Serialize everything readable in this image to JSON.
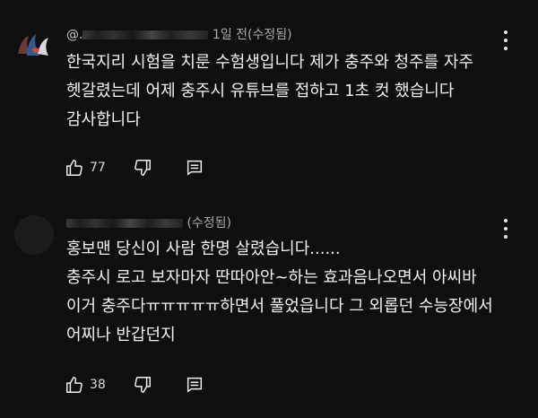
{
  "comments": [
    {
      "handle": "@.",
      "time": "1일 전(수정됨)",
      "lines": [
        "한국지리 시험을 치룬 수험생입니다 제가 충주와 청주를 자주",
        "헷갈렸는데 어제 충주시 유튜브를 접하고 1초 컷 했습니다",
        "감사합니다"
      ],
      "likes": "77"
    },
    {
      "handle": "",
      "time": "(수정됨)",
      "lines": [
        "홍보맨 당신이 사람 한명 살렸습니다......",
        "충주시 로고 보자마자 딴따아안~하는 효과음나오면서 아씨바",
        "이거 충주다ㅠㅠㅠㅠㅠ하면서 풀었읍니다 그 외롭던 수능장에서",
        "어찌나 반갑던지"
      ],
      "likes": "38"
    }
  ],
  "colors": {
    "background": "#0f0f0f",
    "text": "#f1f1f1",
    "meta_text": "#aaaaaa"
  },
  "icons": [
    "thumbs-up-icon",
    "thumbs-down-icon",
    "reply-icon",
    "more-vert-icon"
  ]
}
